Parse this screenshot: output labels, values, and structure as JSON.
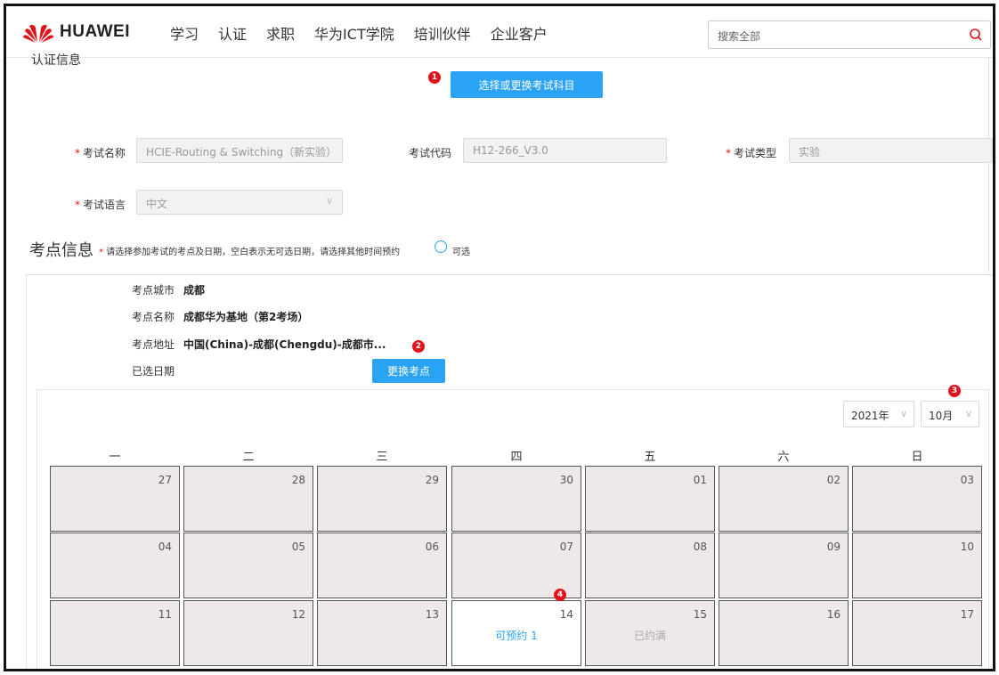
{
  "header": {
    "logo_text": "HUAWEI",
    "nav": [
      "学习",
      "认证",
      "求职",
      "华为ICT学院",
      "培训伙伴",
      "企业客户"
    ],
    "search_placeholder": "搜索全部",
    "brand_color": "#e0131c"
  },
  "cert": {
    "section_title": "认证信息",
    "select_button": "选择或更换考试科目",
    "exam_name_label": "考试名称",
    "exam_name_value": "HCIE-Routing & Switching（新实验）",
    "exam_code_label": "考试代码",
    "exam_code_value": "H12-266_V3.0",
    "exam_type_label": "考试类型",
    "exam_type_value": "实验",
    "exam_lang_label": "考试语言",
    "exam_lang_value": "中文",
    "required_mark": "*"
  },
  "site": {
    "title": "考点信息",
    "note": "请选择参加考试的考点及日期，空白表示无可选日期，请选择其他时间预约",
    "radio_label": "可选",
    "city_label": "考点城市",
    "city_value": "成都",
    "name_label": "考点名称",
    "name_value": "成都华为基地（第2考场）",
    "address_label": "考点地址",
    "address_value": "中国(China)-成都(Chengdu)-成都市...",
    "date_label": "已选日期",
    "date_value": "",
    "change_button": "更换考点"
  },
  "badges": [
    "1",
    "2",
    "3",
    "4"
  ],
  "calendar": {
    "year": "2021年",
    "month": "10月",
    "weekdays": [
      "一",
      "二",
      "三",
      "四",
      "五",
      "六",
      "日"
    ],
    "weeks": [
      [
        {
          "day": "27",
          "status": ""
        },
        {
          "day": "28",
          "status": ""
        },
        {
          "day": "29",
          "status": ""
        },
        {
          "day": "30",
          "status": ""
        },
        {
          "day": "01",
          "status": ""
        },
        {
          "day": "02",
          "status": ""
        },
        {
          "day": "03",
          "status": ""
        }
      ],
      [
        {
          "day": "04",
          "status": ""
        },
        {
          "day": "05",
          "status": ""
        },
        {
          "day": "06",
          "status": ""
        },
        {
          "day": "07",
          "status": ""
        },
        {
          "day": "08",
          "status": ""
        },
        {
          "day": "09",
          "status": ""
        },
        {
          "day": "10",
          "status": ""
        }
      ],
      [
        {
          "day": "11",
          "status": ""
        },
        {
          "day": "12",
          "status": ""
        },
        {
          "day": "13",
          "status": ""
        },
        {
          "day": "14",
          "status": "可预约 1",
          "available": true
        },
        {
          "day": "15",
          "status": "已约满"
        },
        {
          "day": "16",
          "status": ""
        },
        {
          "day": "17",
          "status": ""
        }
      ]
    ]
  }
}
